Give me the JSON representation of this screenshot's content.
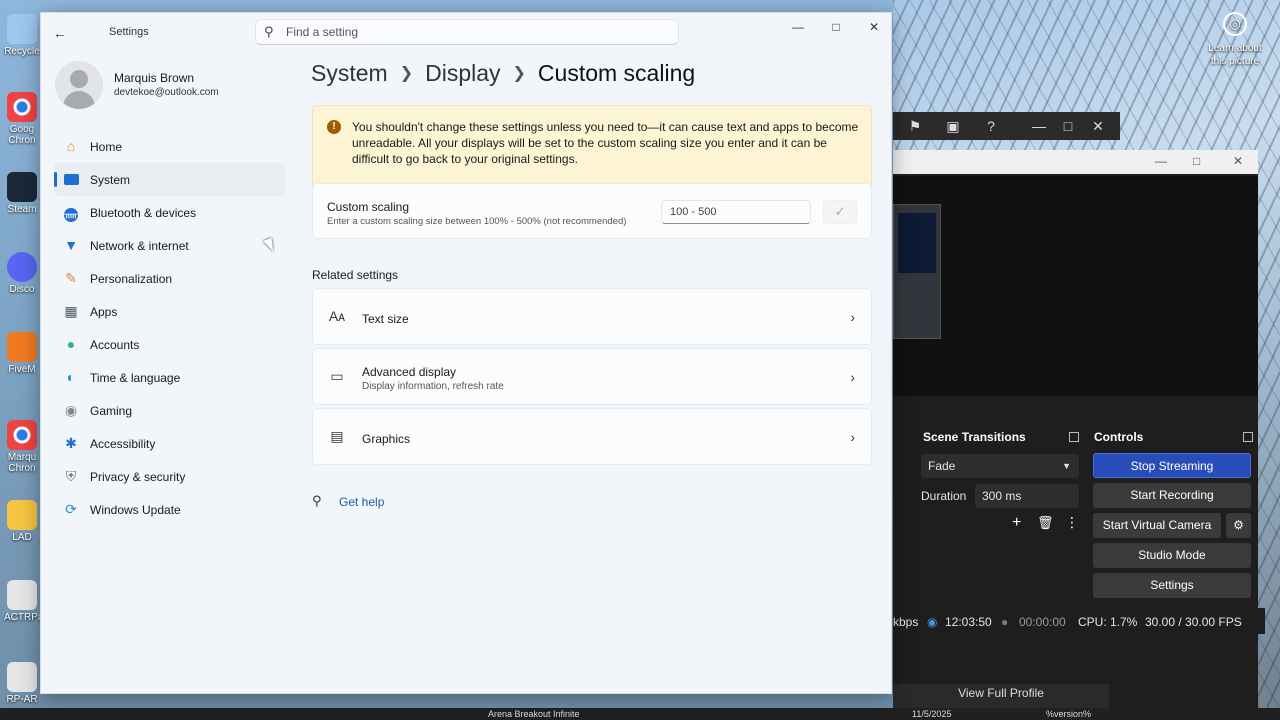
{
  "desktop": {
    "icons": [
      {
        "label": "Recycle",
        "icon": "recycle-bin-icon",
        "color": "#9fc7ef"
      },
      {
        "label": "Goog Chron",
        "icon": "chrome-icon",
        "color": "#2b7de9"
      },
      {
        "label": "Steam",
        "icon": "steam-icon",
        "color": "#1b2838"
      },
      {
        "label": "Disco",
        "icon": "discord-icon",
        "color": "#5865f2"
      },
      {
        "label": "FiveM",
        "icon": "fivem-icon",
        "color": "#f07a22"
      },
      {
        "label": "Marqu Chron",
        "icon": "chrome-icon",
        "color": "#2b7de9"
      },
      {
        "label": "LAD",
        "icon": "folder-icon",
        "color": "#f5c542"
      },
      {
        "label": "ACTRPa",
        "icon": "file-icon",
        "color": "#e6e6e6"
      },
      {
        "label": "RP-AR",
        "icon": "file-icon",
        "color": "#e6e6e6"
      }
    ],
    "learn_about": "Learn about this picture",
    "taskbar": {
      "item": "Arena Breakout Infinite",
      "date": "11/5/2025",
      "version": "%version%"
    }
  },
  "obs": {
    "scene_transitions": {
      "title": "Scene Transitions",
      "transition": "Fade",
      "duration_label": "Duration",
      "duration_value": "300 ms"
    },
    "controls": {
      "title": "Controls",
      "stop_streaming": "Stop Streaming",
      "start_recording": "Start Recording",
      "start_virtual_camera": "Start Virtual Camera",
      "studio_mode": "Studio Mode",
      "settings": "Settings"
    },
    "status": {
      "kbps": "kbps",
      "stream_time": "12:03:50",
      "rec_time": "00:00:00",
      "cpu": "CPU: 1.7%",
      "fps": "30.00 / 30.00 FPS"
    },
    "profile_link": "View Full Profile"
  },
  "settings": {
    "app_title": "Settings",
    "search": {
      "placeholder": "Find a setting"
    },
    "user": {
      "name": "Marquis Brown",
      "email": "devtekoe@outlook.com"
    },
    "nav": [
      {
        "label": "Home",
        "icon": "home-icon",
        "color": "#d98a3d",
        "active": false
      },
      {
        "label": "System",
        "icon": "system-icon",
        "color": "#1e6fd1",
        "active": true
      },
      {
        "label": "Bluetooth & devices",
        "icon": "bluetooth-icon",
        "color": "#1e6fd1",
        "active": false
      },
      {
        "label": "Network & internet",
        "icon": "wifi-icon",
        "color": "#1e6fd1",
        "active": false
      },
      {
        "label": "Personalization",
        "icon": "brush-icon",
        "color": "#d98a3d",
        "active": false
      },
      {
        "label": "Apps",
        "icon": "apps-icon",
        "color": "#4a5a6a",
        "active": false
      },
      {
        "label": "Accounts",
        "icon": "accounts-icon",
        "color": "#2fb58a",
        "active": false
      },
      {
        "label": "Time & language",
        "icon": "globe-icon",
        "color": "#1e8fd1",
        "active": false
      },
      {
        "label": "Gaming",
        "icon": "gamepad-icon",
        "color": "#888888",
        "active": false
      },
      {
        "label": "Accessibility",
        "icon": "accessibility-icon",
        "color": "#1e6fd1",
        "active": false
      },
      {
        "label": "Privacy & security",
        "icon": "shield-icon",
        "color": "#777777",
        "active": false
      },
      {
        "label": "Windows Update",
        "icon": "update-icon",
        "color": "#1e8fd1",
        "active": false
      }
    ],
    "breadcrumb": [
      "System",
      "Display",
      "Custom scaling"
    ],
    "warning": "You shouldn't change these settings unless you need to—it can cause text and apps to become unreadable. All your displays will be set to the custom scaling size you enter and it can be difficult to go back to your original settings.",
    "custom_scaling": {
      "title": "Custom scaling",
      "subtitle": "Enter a custom scaling size between 100% - 500% (not recommended)",
      "placeholder": "100 - 500"
    },
    "related_header": "Related settings",
    "related": [
      {
        "title": "Text size",
        "subtitle": "",
        "icon": "text-size-icon"
      },
      {
        "title": "Advanced display",
        "subtitle": "Display information, refresh rate",
        "icon": "monitor-icon"
      },
      {
        "title": "Graphics",
        "subtitle": "",
        "icon": "graphics-card-icon"
      }
    ],
    "get_help": "Get help",
    "accent": "#1e6fd1"
  }
}
